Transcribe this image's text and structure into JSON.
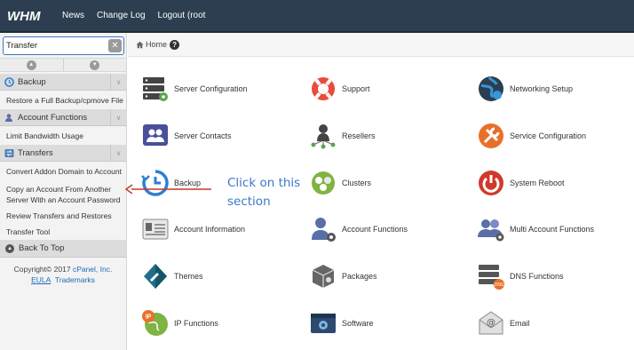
{
  "topbar": {
    "logo_text": "WHM",
    "nav": [
      "News",
      "Change Log",
      "Logout (root"
    ]
  },
  "sidebar": {
    "search": {
      "value": "Transfer",
      "placeholder": ""
    },
    "sections": [
      {
        "label": "Backup",
        "icon": "backup-icon",
        "items": [
          "Restore a Full Backup/cpmove File"
        ]
      },
      {
        "label": "Account Functions",
        "icon": "account-functions-icon",
        "items": [
          "Limit Bandwidth Usage"
        ]
      },
      {
        "label": "Transfers",
        "icon": "transfers-icon",
        "items": [
          "Convert Addon Domain to Account",
          "Copy an Account From Another",
          "Server With an Account Password",
          "Review Transfers and Restores",
          "Transfer Tool"
        ]
      }
    ],
    "back_to_top": "Back To Top",
    "footer": {
      "copyright": "Copyright© 2017",
      "brand": "cPanel, Inc.",
      "eula": "EULA",
      "trademarks": "Trademarks"
    }
  },
  "main": {
    "breadcrumb": "Home",
    "apps": [
      {
        "label": "Server Configuration",
        "icon": "server-configuration-icon"
      },
      {
        "label": "Support",
        "icon": "support-lifebuoy-icon"
      },
      {
        "label": "Networking Setup",
        "icon": "networking-globe-icon"
      },
      {
        "label": "Server Contacts",
        "icon": "server-contacts-icon"
      },
      {
        "label": "Resellers",
        "icon": "resellers-icon"
      },
      {
        "label": "Service Configuration",
        "icon": "service-configuration-wrench-icon"
      },
      {
        "label": "Backup",
        "icon": "backup-clock-icon"
      },
      {
        "label": "Clusters",
        "icon": "clusters-icon"
      },
      {
        "label": "System Reboot",
        "icon": "power-icon"
      },
      {
        "label": "Account Information",
        "icon": "account-information-icon"
      },
      {
        "label": "Account Functions",
        "icon": "account-functions-user-icon"
      },
      {
        "label": "Multi Account Functions",
        "icon": "multi-account-icon"
      },
      {
        "label": "Themes",
        "icon": "themes-icon"
      },
      {
        "label": "Packages",
        "icon": "packages-box-icon"
      },
      {
        "label": "DNS Functions",
        "icon": "dns-functions-icon"
      },
      {
        "label": "IP Functions",
        "icon": "ip-functions-icon"
      },
      {
        "label": "Software",
        "icon": "software-window-icon"
      },
      {
        "label": "Email",
        "icon": "email-icon"
      }
    ]
  },
  "annotation": {
    "line1": "Click on this",
    "line2": "section",
    "color": "#3a77c9",
    "arrow_color": "#c0392b"
  },
  "colors": {
    "topbar": "#2c3e50",
    "accent": "#3c78c3"
  }
}
